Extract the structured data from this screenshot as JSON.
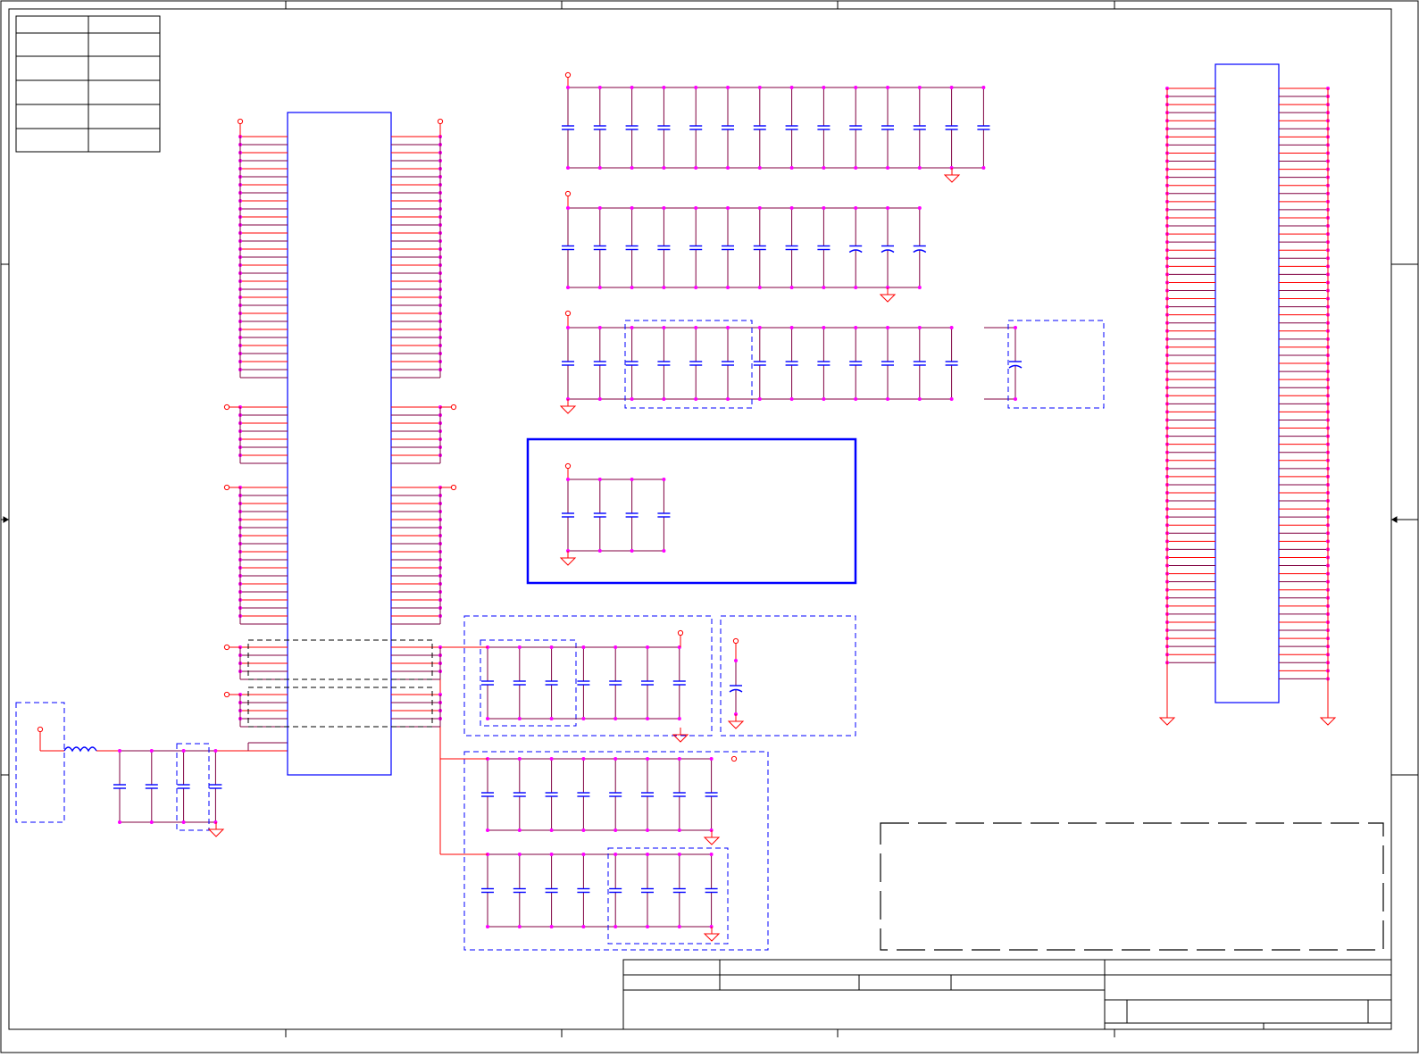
{
  "schematic": {
    "colors": {
      "wire": "#ff0000",
      "wire_dark": "#800040",
      "net_junction": "#ff00ff",
      "component_blue": "#0000ff",
      "group_box_blue": "#0000ff",
      "group_box_black": "#000000",
      "border": "#000000",
      "background": "#ffffff"
    },
    "icons": {
      "capacitor": "capacitor-icon",
      "polarized_capacitor": "polarized-capacitor-icon",
      "inductor": "inductor-icon",
      "ground": "ground-icon",
      "power_port": "power-port-icon"
    },
    "capacitor_banks": [
      {
        "name": "bank-1",
        "count": 14,
        "polarized_last": 0,
        "has_group_box": false
      },
      {
        "name": "bank-2",
        "count": 12,
        "polarized_last": 3,
        "has_group_box": false
      },
      {
        "name": "bank-3",
        "count": 14,
        "polarized_last": 1,
        "has_group_box": true
      },
      {
        "name": "bank-4",
        "count": 4,
        "polarized_last": 0,
        "has_group_box": true
      },
      {
        "name": "bank-5",
        "count": 7,
        "polarized_last": 0,
        "has_group_box": true
      },
      {
        "name": "bank-6",
        "count": 1,
        "polarized_last": 1,
        "has_group_box": true
      },
      {
        "name": "bank-7",
        "count": 8,
        "polarized_last": 0,
        "has_group_box": true
      },
      {
        "name": "bank-8",
        "count": 8,
        "polarized_last": 0,
        "has_group_box": true
      },
      {
        "name": "filter-bank",
        "count": 4,
        "polarized_last": 0,
        "has_group_box": true
      }
    ],
    "ic_left": {
      "left_pin_groups": [
        30,
        7,
        17,
        4,
        4
      ],
      "right_pin_groups": [
        30,
        7,
        17,
        4,
        4
      ]
    },
    "connector_right": {
      "left_pins": 72,
      "right_pins": 74
    },
    "revision_table_rows": 6,
    "title_block": {
      "title": "",
      "number": "",
      "revision": "",
      "sheet": ""
    }
  }
}
